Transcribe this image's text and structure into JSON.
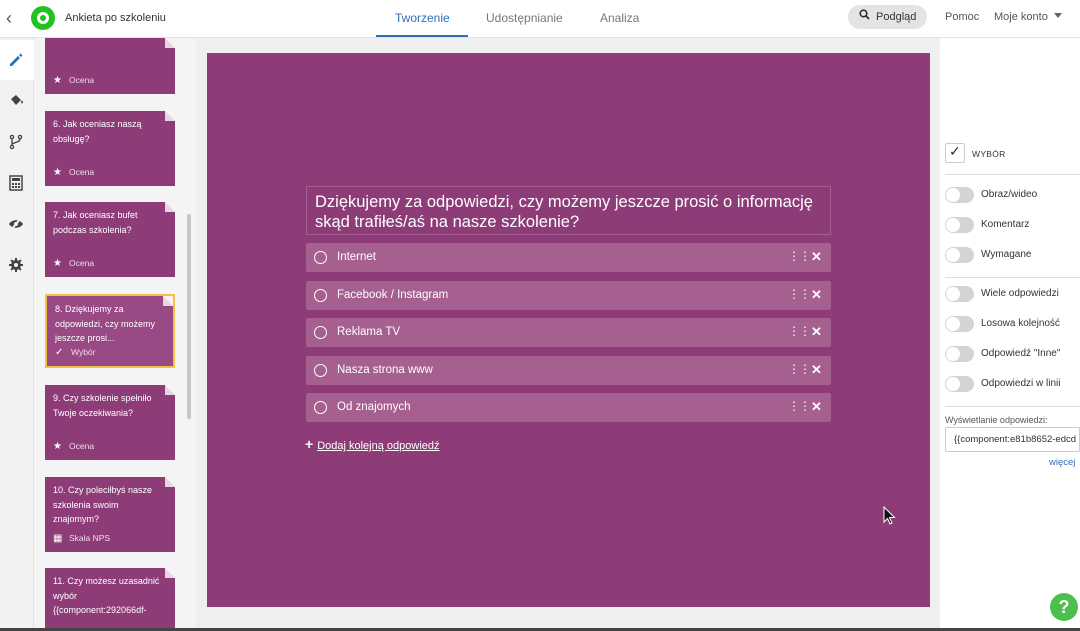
{
  "header": {
    "app_title": "Ankieta po szkoleniu",
    "tabs": [
      {
        "label": "Tworzenie",
        "active": true
      },
      {
        "label": "Udostępnianie",
        "active": false
      },
      {
        "label": "Analiza",
        "active": false
      }
    ],
    "preview_label": "Podgląd",
    "help_label": "Pomoc",
    "account_label": "Moje konto",
    "brand_color": "#22c222",
    "accent_color": "#2f6fb8"
  },
  "rail": {
    "items": [
      {
        "icon": "pencil-icon",
        "active": true
      },
      {
        "icon": "paint-bucket-icon",
        "active": false
      },
      {
        "icon": "branch-icon",
        "active": false
      },
      {
        "icon": "calculator-icon",
        "active": false
      },
      {
        "icon": "eye-slash-icon",
        "active": false
      },
      {
        "icon": "gear-icon",
        "active": false
      }
    ]
  },
  "questions": [
    {
      "text": "",
      "type": "Ocena",
      "type_icon": "star-icon"
    },
    {
      "text": "6. Jak oceniasz naszą obsługę?",
      "type": "Ocena",
      "type_icon": "star-icon"
    },
    {
      "text": "7. Jak oceniasz bufet podczas szkolenia?",
      "type": "Ocena",
      "type_icon": "star-icon"
    },
    {
      "text": "8. Dziękujemy za odpowiedzi, czy możemy jeszcze prosi...",
      "type": "Wybór",
      "type_icon": "check-icon",
      "selected": true
    },
    {
      "text": "9. Czy szkolenie spełniło Twoje oczekiwania?",
      "type": "Ocena",
      "type_icon": "star-icon"
    },
    {
      "text": "10. Czy poleciłbyś nasze szkolenia swoim znajomym?",
      "type": "Skala NPS",
      "type_icon": "bar-chart-icon"
    },
    {
      "text": "11. Czy możesz uzasadnić wybór {{component:292066df-",
      "type": "",
      "type_icon": "grid-icon"
    }
  ],
  "editor": {
    "question": "Dziękujemy za odpowiedzi, czy możemy jeszcze prosić o informację skąd trafiłeś/aś na nasze szkolenie?",
    "answers": [
      "Internet",
      "Facebook / Instagram",
      "Reklama TV",
      "Nasza strona www",
      "Od znajomych"
    ],
    "add_answer_label": "Dodaj kolejną odpowiedź",
    "slide_color": "#8e3c78"
  },
  "settings": {
    "type_label": "WYBÓR",
    "type_checked": true,
    "toggles_group1": [
      {
        "label": "Obraz/wideo",
        "on": false
      },
      {
        "label": "Komentarz",
        "on": false
      },
      {
        "label": "Wymagane",
        "on": false
      }
    ],
    "toggles_group2": [
      {
        "label": "Wiele odpowiedzi",
        "on": false
      },
      {
        "label": "Losowa kolejność",
        "on": false
      },
      {
        "label": "Odpowiedź \"Inne\"",
        "on": false
      },
      {
        "label": "Odpowiedzi w linii",
        "on": false
      }
    ],
    "display_label": "Wyświetlanie odpowiedzi:",
    "display_value": "{{component:e81b8652-edcd",
    "more_label": "więcej"
  }
}
